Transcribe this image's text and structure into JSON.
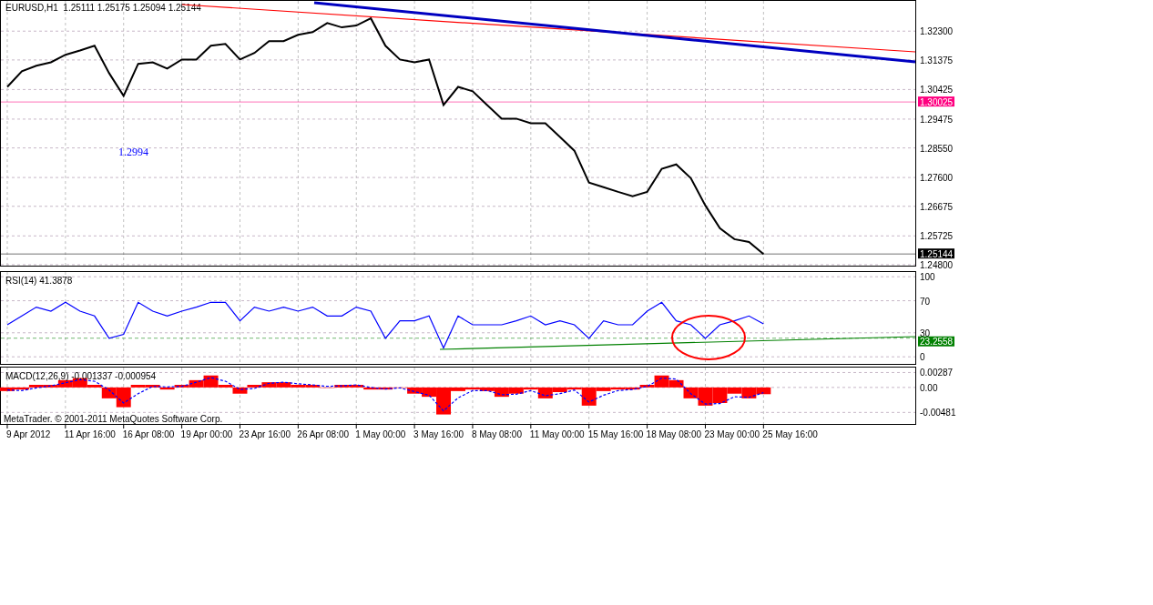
{
  "price_panel": {
    "chart_data": {
      "type": "line",
      "title": "EURUSD,H1  1.25111 1.25175 1.25094 1.25144",
      "grid": true,
      "ylim": [
        1.2474,
        1.333
      ],
      "series": [
        {
          "color": "#000000",
          "values": [
            1.3051,
            1.3101,
            1.3119,
            1.313,
            1.3154,
            1.3168,
            1.3183,
            1.3095,
            1.3022,
            1.3125,
            1.313,
            1.311,
            1.3139,
            1.3139,
            1.3183,
            1.3189,
            1.3139,
            1.316,
            1.3198,
            1.3198,
            1.3218,
            1.3227,
            1.3256,
            1.3242,
            1.3248,
            1.3271,
            1.3183,
            1.3139,
            1.313,
            1.3139,
            1.2993,
            1.3051,
            1.3037,
            1.2993,
            1.2949,
            1.2949,
            1.2934,
            1.2934,
            1.289,
            1.2846,
            1.2744,
            1.2729,
            1.2714,
            1.27,
            1.2714,
            1.2788,
            1.2802,
            1.2758,
            1.267,
            1.2597,
            1.2562,
            1.2553,
            1.2514
          ]
        }
      ],
      "yticks": [
        {
          "value": 1.323,
          "label": "1.32300"
        },
        {
          "value": 1.31375,
          "label": "1.31375"
        },
        {
          "value": 1.30425,
          "label": "1.30425"
        },
        {
          "value": 1.29475,
          "label": "1.29475"
        },
        {
          "value": 1.2855,
          "label": "1.28550"
        },
        {
          "value": 1.276,
          "label": "1.27600"
        },
        {
          "value": 1.26675,
          "label": "1.26675"
        },
        {
          "value": 1.25725,
          "label": "1.25725"
        },
        {
          "value": 1.248,
          "label": "1.24800"
        }
      ],
      "ref_lines": [
        {
          "axis": "y",
          "value": 1.30025,
          "label": "1.30025",
          "color": "#ff0080"
        },
        {
          "axis": "y",
          "value": 1.25144,
          "label": "1.25144",
          "color": "#000000"
        }
      ],
      "annotations": [
        "1.2994"
      ]
    }
  },
  "rsi_panel": {
    "chart_data": {
      "type": "line",
      "title": "RSI(14) 41.3878",
      "grid": true,
      "ylim": [
        -10,
        107
      ],
      "series": [
        {
          "color": "#0000ff",
          "values": [
            40,
            51,
            62,
            57,
            68,
            57,
            51,
            23,
            28,
            68,
            57,
            51,
            57,
            62,
            68,
            68,
            45,
            62,
            57,
            62,
            57,
            62,
            51,
            51,
            62,
            57,
            23,
            45,
            45,
            51,
            11,
            51,
            40,
            40,
            40,
            45,
            51,
            40,
            45,
            40,
            23,
            45,
            40,
            40,
            57,
            68,
            45,
            40,
            23,
            40,
            45,
            51,
            41
          ]
        }
      ],
      "yticks": [
        100,
        70,
        30,
        0
      ],
      "ref_lines": [
        {
          "axis": "y",
          "value": 23.2558,
          "label": "23.2558",
          "color": "#008000"
        }
      ]
    }
  },
  "macd_panel": {
    "chart_data": {
      "type": "bar",
      "grid": true,
      "title": "MACD(12,26,9) -0.001337 -0.000954",
      "categories": [
        null,
        null,
        "9 Apr 2012",
        null,
        null,
        null,
        "11 Apr 16:00",
        null,
        null,
        null,
        "16 Apr 08:00",
        null,
        null,
        null,
        "19 Apr 00:00",
        null,
        null,
        null,
        "23 Apr 16:00",
        null,
        null,
        null,
        "26 Apr 08:00",
        null,
        null,
        null,
        "1 May 00:00",
        null,
        null,
        null,
        "3 May 16:00",
        null,
        null,
        null,
        "8 May 08:00",
        null,
        null,
        null,
        "11 May 00:00",
        null,
        null,
        null,
        "15 May 16:00",
        null,
        null,
        null,
        "18 May 08:00",
        null,
        null,
        null,
        "23 May 00:00",
        null,
        null,
        null,
        "25 May 16:00",
        null,
        null,
        null,
        null,
        null,
        null,
        null,
        null
      ],
      "ylim": [
        -0.0072,
        0.004
      ],
      "series": [
        {
          "type": "bar",
          "color": "#ff0000",
          "values": [
            -0.0007,
            -0.0004,
            0.0005,
            0.0005,
            0.0014,
            0.0018,
            0.0005,
            -0.0021,
            -0.0038,
            0.0005,
            0.0005,
            -0.0004,
            0.0005,
            0.0014,
            0.0023,
            0.0005,
            -0.0012,
            0.0005,
            0.001,
            0.001,
            0.0005,
            0.0005,
            0,
            0.0005,
            0.0005,
            -0.0004,
            -0.0004,
            0,
            -0.0012,
            -0.0018,
            -0.0052,
            -0.0007,
            -0.0004,
            -0.0007,
            -0.0018,
            -0.0012,
            -0.0004,
            -0.0021,
            -0.0009,
            -0.0004,
            -0.0035,
            -0.0007,
            -0.0004,
            -0.0004,
            0.0005,
            0.0023,
            0.0014,
            -0.0021,
            -0.0035,
            -0.003,
            -0.0012,
            -0.0021,
            -0.0013,
            null,
            null,
            null,
            null,
            null,
            null,
            null,
            null,
            null,
            null
          ]
        },
        {
          "type": "line",
          "line_style": "dashed",
          "color": "#0000ff",
          "values": [
            -0.0005,
            -0.0006,
            -0.0001,
            0.0003,
            0.0009,
            0.0015,
            0.0012,
            -0.0005,
            -0.003,
            -0.0012,
            0.0002,
            0.0001,
            0.0002,
            0.001,
            0.0019,
            0.0012,
            -0.0004,
            -0.0002,
            0.0008,
            0.001,
            0.0007,
            0.0005,
            0.0002,
            0.0003,
            0.0005,
            0,
            -0.0003,
            -0.0001,
            -0.0008,
            -0.0015,
            -0.0045,
            -0.002,
            -0.0006,
            -0.0006,
            -0.0014,
            -0.0013,
            -0.0006,
            -0.0016,
            -0.0012,
            -0.0005,
            -0.0028,
            -0.0015,
            -0.0006,
            -0.0004,
            0.0002,
            0.0018,
            0.0016,
            -0.0012,
            -0.0032,
            -0.0031,
            -0.0018,
            -0.0019,
            -0.001,
            null,
            null,
            null,
            null,
            null,
            null,
            null,
            null,
            null,
            null
          ]
        }
      ],
      "yticks": [
        {
          "value": 0.00287,
          "label": "0.00287"
        },
        {
          "value": 0,
          "label": "0.00"
        },
        {
          "value": -0.00481,
          "label": "-0.00481"
        }
      ]
    },
    "copyright": "MetaTrader. © 2001-2011 MetaQuotes Software Corp."
  }
}
